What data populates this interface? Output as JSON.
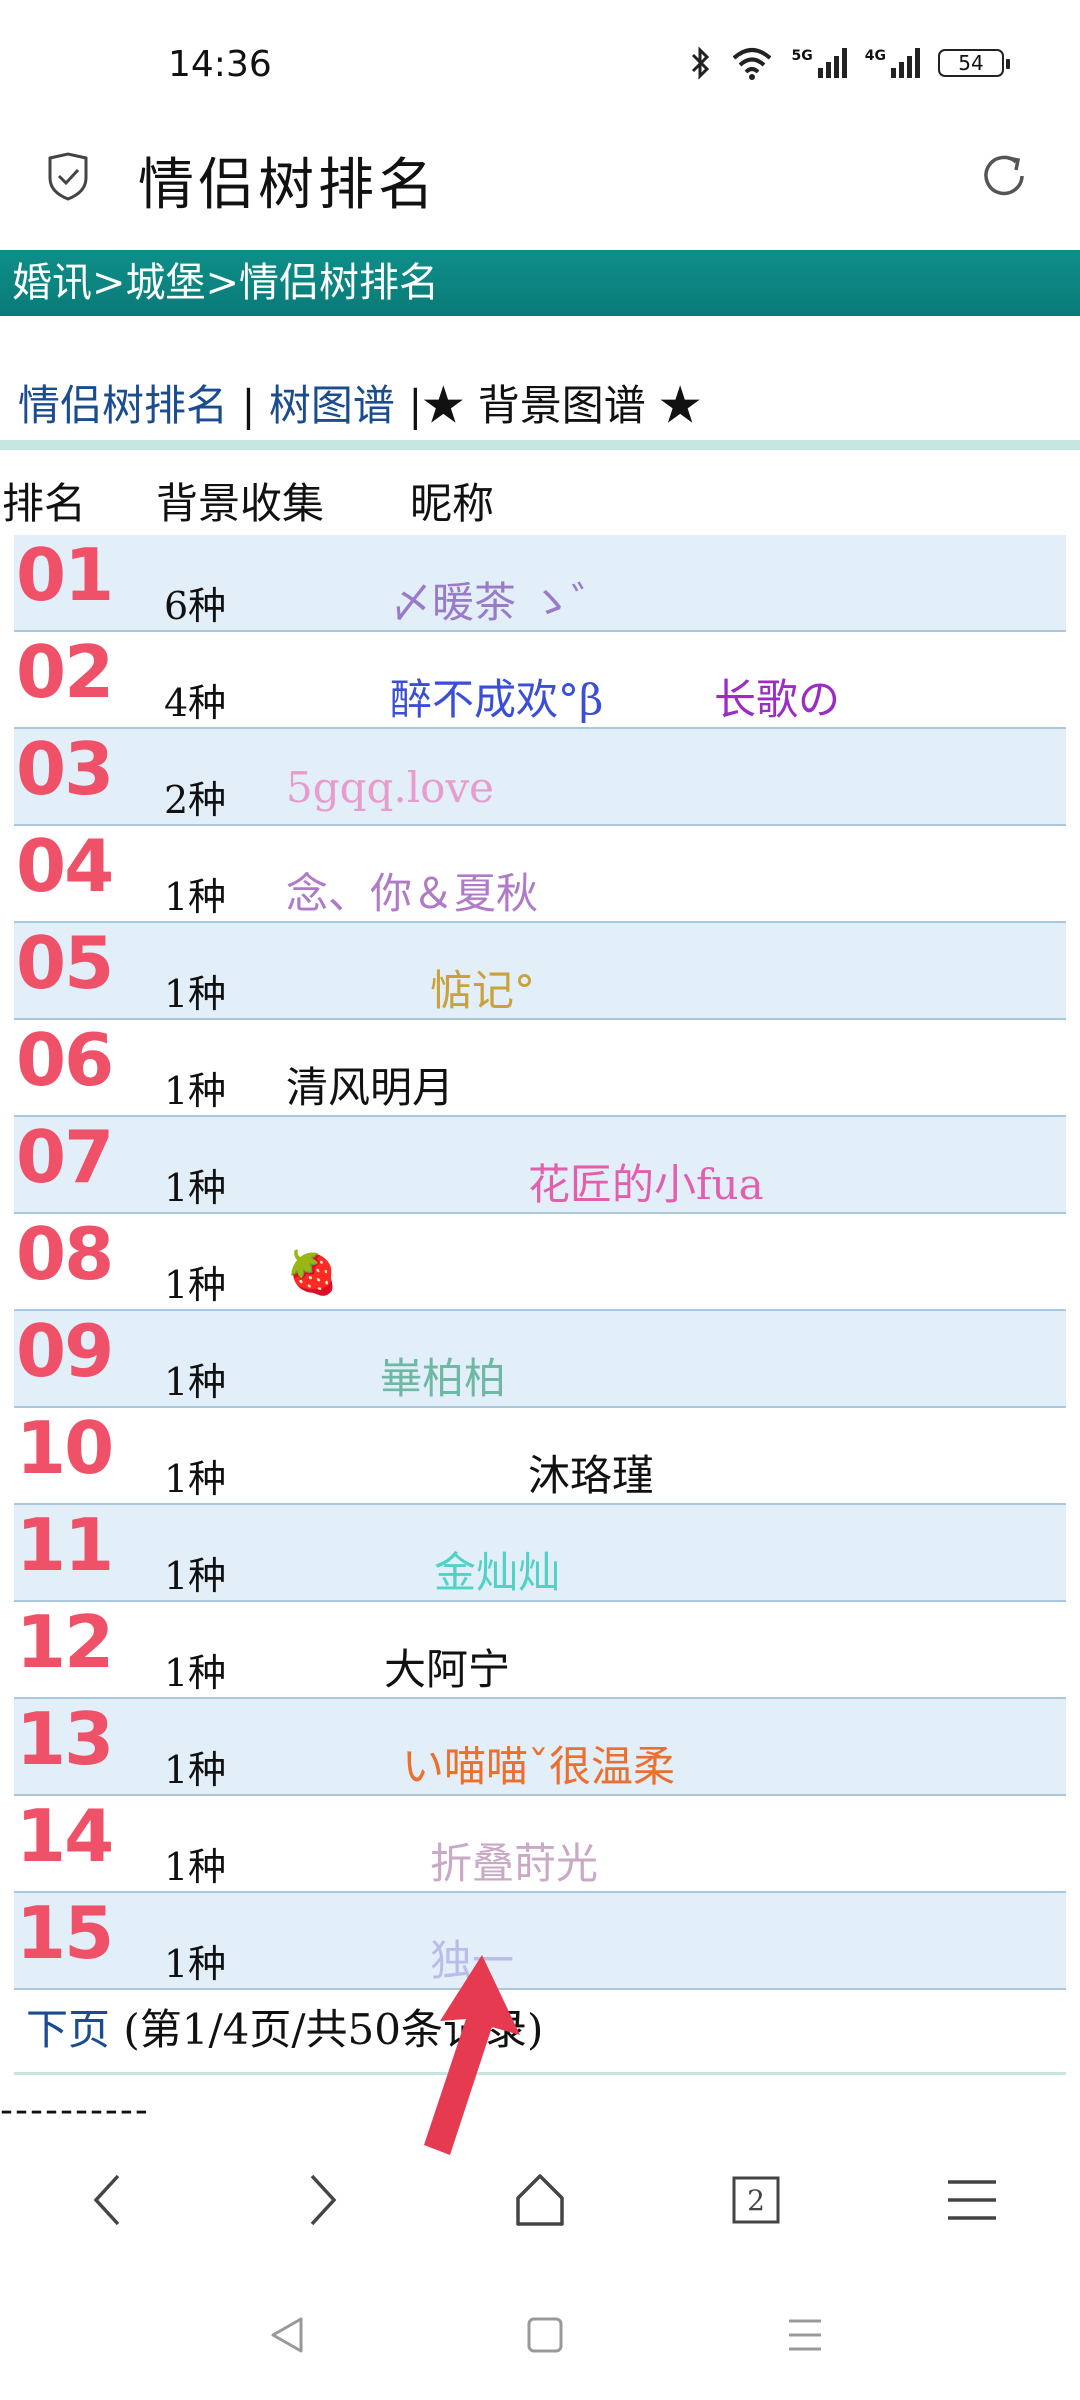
{
  "status": {
    "time": "14:36",
    "battery": "54",
    "signal1_label": "5G",
    "signal2_label": "4G",
    "icons": [
      "bluetooth-icon",
      "wifi-icon",
      "signal-5g-icon",
      "signal-4g-icon",
      "battery-icon"
    ]
  },
  "header": {
    "title": "情侣树排名"
  },
  "breadcrumb": "婚讯>城堡>情侣树排名",
  "nav": {
    "link1": "情侣树排名",
    "sep1": " | ",
    "link2": "树图谱",
    "sep2": " |",
    "current": "★ 背景图谱 ★"
  },
  "table": {
    "headers": [
      "排名",
      "背景收集",
      "昵称"
    ],
    "rows": [
      {
        "rank": "01",
        "count": "6种",
        "nickname": "〆暖茶 ゝ゛",
        "color": "#9a7bc9"
      },
      {
        "rank": "02",
        "count": "4种",
        "nickname": "醉不成欢°β",
        "nickname2": "长歌の",
        "color": "#3a4fd6",
        "color2": "#9b2cc4"
      },
      {
        "rank": "03",
        "count": "2种",
        "nickname": "5gqq.love",
        "color": "#e79ccd"
      },
      {
        "rank": "04",
        "count": "1种",
        "nickname": "念、你＆夏秋",
        "color": "#b07ac8"
      },
      {
        "rank": "05",
        "count": "1种",
        "nickname": "惦记°",
        "color": "#c9a23a"
      },
      {
        "rank": "06",
        "count": "1种",
        "nickname": "清风明月",
        "color": "#111111"
      },
      {
        "rank": "07",
        "count": "1种",
        "nickname": "花匠的小fua",
        "color": "#e25fae"
      },
      {
        "rank": "08",
        "count": "1种",
        "nickname": "🍓",
        "color": "#d8232a"
      },
      {
        "rank": "09",
        "count": "1种",
        "nickname": "崋柏柏",
        "color": "#6fb8a4"
      },
      {
        "rank": "10",
        "count": "1种",
        "nickname": "沐珞瑾",
        "color": "#111111"
      },
      {
        "rank": "11",
        "count": "1种",
        "nickname": "金灿灿",
        "color": "#4fd3c6"
      },
      {
        "rank": "12",
        "count": "1种",
        "nickname": "大阿宁",
        "color": "#111111"
      },
      {
        "rank": "13",
        "count": "1种",
        "nickname": "い喵喵ˇ很温柔",
        "color": "#ec6f2e"
      },
      {
        "rank": "14",
        "count": "1种",
        "nickname": "折叠莳光",
        "color": "#c9a9c6"
      },
      {
        "rank": "15",
        "count": "1种",
        "nickname": "独一",
        "color": "#b9bde8"
      }
    ]
  },
  "pager": {
    "next": "下页",
    "info": " (第1/4页/共50条记录)"
  },
  "footer_dashes": "----------",
  "browser_nav": {
    "tabs_count": "2"
  },
  "colors": {
    "accent_teal": "#0e8f8a",
    "rank_red": "#ef5168",
    "row_alt": "#e2eef8",
    "link_blue": "#1a4c8f"
  }
}
